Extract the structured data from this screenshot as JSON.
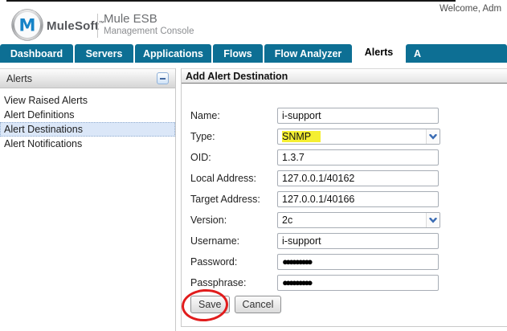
{
  "header": {
    "welcome_text": "Welcome, Adm",
    "brand": {
      "company": "MuleSoft",
      "trademark": "™",
      "logo_letter": "M",
      "product": "Mule ESB",
      "subtitle": "Management Console"
    }
  },
  "nav": {
    "tabs": [
      {
        "label": "Dashboard",
        "active": false
      },
      {
        "label": "Servers",
        "active": false
      },
      {
        "label": "Applications",
        "active": false
      },
      {
        "label": "Flows",
        "active": false
      },
      {
        "label": "Flow Analyzer",
        "active": false
      },
      {
        "label": "Alerts",
        "active": true
      },
      {
        "label": "A",
        "active": false,
        "clipped_at_edge": true
      }
    ]
  },
  "sidebar": {
    "title": "Alerts",
    "collapse_icon": "minus-icon",
    "items": [
      {
        "label": "View Raised Alerts",
        "selected": false
      },
      {
        "label": "Alert Definitions",
        "selected": false
      },
      {
        "label": "Alert Destinations",
        "selected": true
      },
      {
        "label": "Alert Notifications",
        "selected": false
      }
    ]
  },
  "main": {
    "title": "Add Alert Destination",
    "form": {
      "fields": [
        {
          "label": "Name:",
          "type": "text",
          "value": "i-support"
        },
        {
          "label": "Type:",
          "type": "select",
          "value": "SNMP",
          "highlighted": true
        },
        {
          "label": "OID:",
          "type": "text",
          "value": "1.3.7"
        },
        {
          "label": "Local Address:",
          "type": "text",
          "value": "127.0.0.1/40162"
        },
        {
          "label": "Target Address:",
          "type": "text",
          "value": "127.0.0.1/40166"
        },
        {
          "label": "Version:",
          "type": "select",
          "value": "2c"
        },
        {
          "label": "Username:",
          "type": "text",
          "value": "i-support"
        },
        {
          "label": "Password:",
          "type": "password",
          "value": "●●●●●●●●●"
        },
        {
          "label": "Passphrase:",
          "type": "password",
          "value": "●●●●●●●●●"
        }
      ],
      "buttons": {
        "save": "Save",
        "cancel": "Cancel"
      }
    },
    "annotation": {
      "shape": "ellipse",
      "color": "#e11c1c",
      "target": "save-button"
    }
  },
  "colors": {
    "tab_teal": "#0d6f94",
    "highlight_yellow": "#f5ef32",
    "selected_item_bg": "#dbe7f8",
    "annotation_red": "#e11c1c"
  }
}
